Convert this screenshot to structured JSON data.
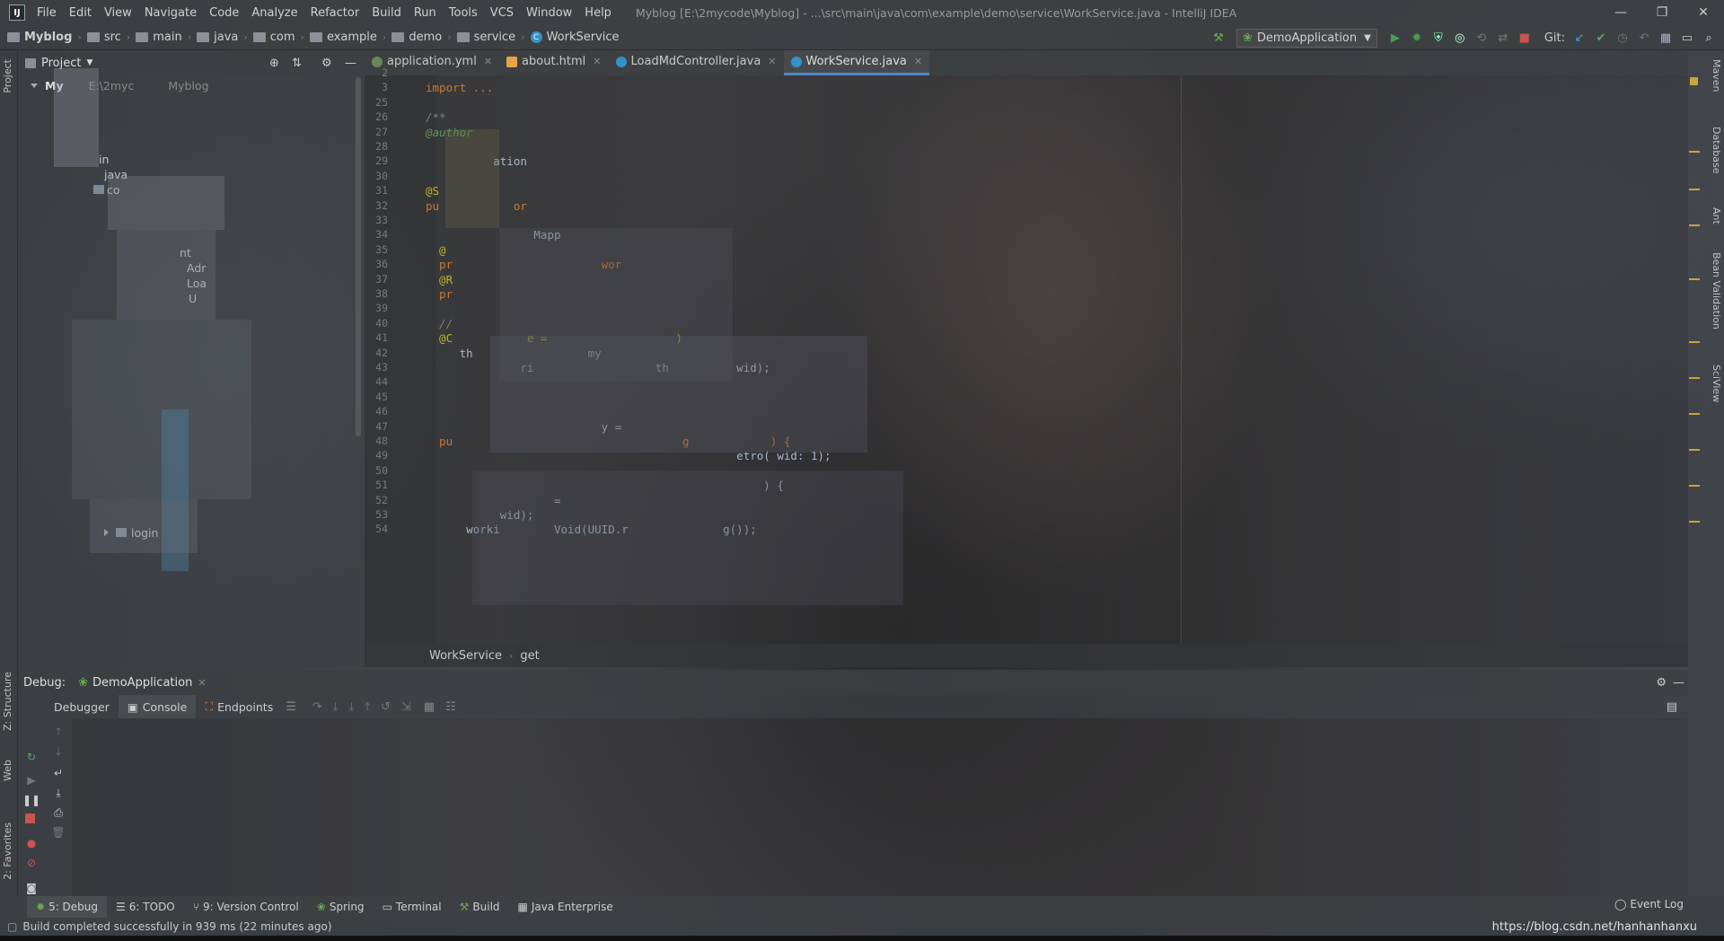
{
  "window": {
    "title": "Myblog [E:\\2mycode\\Myblog] - ...\\src\\main\\java\\com\\example\\demo\\service\\WorkService.java - IntelliJ IDEA",
    "controls": [
      "—",
      "❐",
      "✕"
    ]
  },
  "menu": [
    "File",
    "Edit",
    "View",
    "Navigate",
    "Code",
    "Analyze",
    "Refactor",
    "Build",
    "Run",
    "Tools",
    "VCS",
    "Window",
    "Help"
  ],
  "breadcrumb": [
    "Myblog",
    "src",
    "main",
    "java",
    "com",
    "example",
    "demo",
    "service",
    "WorkService"
  ],
  "run_config": "DemoApplication",
  "git_label": "Git:",
  "project_panel": {
    "title": "Project",
    "root_label": "My",
    "root_path": "E:\\2myc",
    "root_suffix": "Myblog",
    "items": [
      "in",
      "java",
      "co",
      "nt",
      "Adr",
      "Loa",
      "U"
    ],
    "login": "login"
  },
  "editor_tabs": [
    {
      "label": "application.yml",
      "color": "#6a8759"
    },
    {
      "label": "about.html",
      "color": "#e8a24a"
    },
    {
      "label": "LoadMdController.java",
      "color": "#3592c4"
    },
    {
      "label": "WorkService.java",
      "color": "#3592c4"
    }
  ],
  "code_lines": [
    {
      "n": "2",
      "text": ""
    },
    {
      "n": "3",
      "text": "import ..."
    },
    {
      "n": "25",
      "text": ""
    },
    {
      "n": "26",
      "text": "/**"
    },
    {
      "n": "27",
      "text": "@author"
    },
    {
      "n": "28",
      "text": ""
    },
    {
      "n": "29",
      "text": "          ation"
    },
    {
      "n": "30",
      "text": ""
    },
    {
      "n": "31",
      "text": "@S"
    },
    {
      "n": "32",
      "text": "pu           or"
    },
    {
      "n": "33",
      "text": ""
    },
    {
      "n": "34",
      "text": "                Mapp"
    },
    {
      "n": "35",
      "text": "  @"
    },
    {
      "n": "36",
      "text": "  pr                      wor"
    },
    {
      "n": "37",
      "text": "  @R"
    },
    {
      "n": "38",
      "text": "  pr"
    },
    {
      "n": "39",
      "text": ""
    },
    {
      "n": "40",
      "text": "  //"
    },
    {
      "n": "41",
      "text": "  @C           e =                   )"
    },
    {
      "n": "42",
      "text": "     th                 my"
    },
    {
      "n": "43",
      "text": "              ri                  th          wid);"
    },
    {
      "n": "44",
      "text": ""
    },
    {
      "n": "45",
      "text": ""
    },
    {
      "n": "46",
      "text": ""
    },
    {
      "n": "47",
      "text": "                          y ="
    },
    {
      "n": "48",
      "text": "  pu                                  g            ) {"
    },
    {
      "n": "49",
      "text": "                                              etro( wid: 1);"
    },
    {
      "n": "50",
      "text": ""
    },
    {
      "n": "51",
      "text": "                                                  ) {"
    },
    {
      "n": "52",
      "text": "                   ="
    },
    {
      "n": "53",
      "text": "           wid);"
    },
    {
      "n": "54",
      "text": "      worki        Void(UUID.r              g());"
    }
  ],
  "editor_crumbs": [
    "WorkService",
    "get"
  ],
  "debug": {
    "label": "Debug:",
    "session": "DemoApplication",
    "tabs": [
      "Debugger",
      "Console",
      "Endpoints"
    ]
  },
  "bottom_tabs": [
    "5: Debug",
    "6: TODO",
    "9: Version Control",
    "Spring",
    "Terminal",
    "Build",
    "Java Enterprise"
  ],
  "event_log": "Event Log",
  "status": "Build completed successfully in 939 ms (22 minutes ago)",
  "watermark": "https://blog.csdn.net/hanhanhanxu",
  "left_tool_tabs": [
    "Project",
    "Z: Structure",
    "Web",
    "2: Favorites"
  ],
  "right_tool_tabs": [
    "Maven",
    "Database",
    "Ant",
    "Bean Validation",
    "SciView"
  ]
}
